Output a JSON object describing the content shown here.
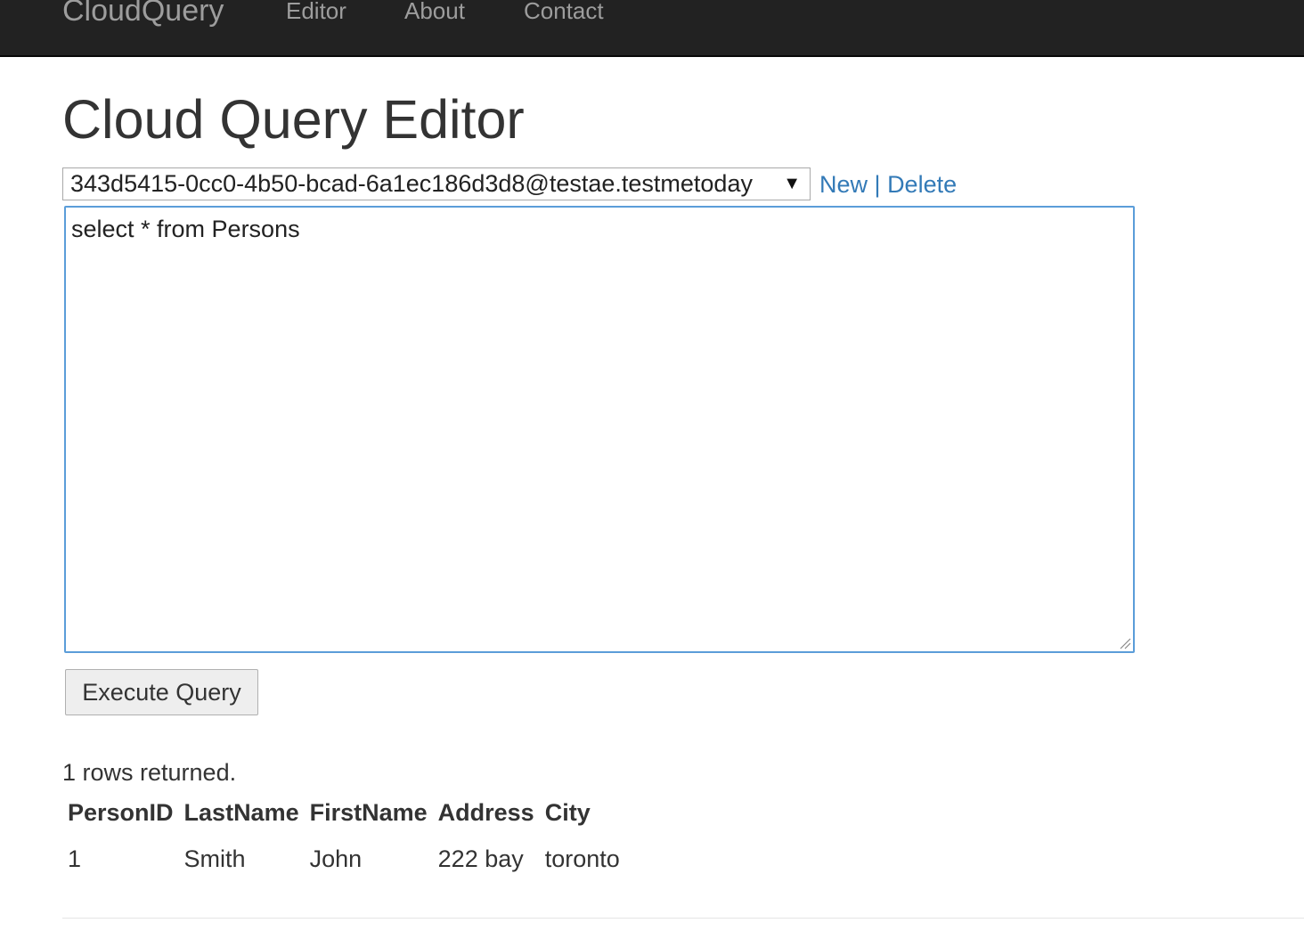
{
  "navbar": {
    "brand": "CloudQuery",
    "links": [
      {
        "label": "Editor"
      },
      {
        "label": "About"
      },
      {
        "label": "Contact"
      }
    ],
    "background": "#222222"
  },
  "page": {
    "title": "Cloud Query Editor"
  },
  "database_select": {
    "selected": "343d5415-0cc0-4b50-bcad-6a1ec186d3d8@testae.testmetoday",
    "arrow": "▼"
  },
  "actions": {
    "new_label": "New",
    "separator": "|",
    "delete_label": "Delete",
    "link_color": "#337ab7"
  },
  "query": {
    "text": "select * from Persons",
    "border_color": "#5b9dd9"
  },
  "execute_button": {
    "label": "Execute Query"
  },
  "results": {
    "status": "1 rows returned.",
    "columns": [
      "PersonID",
      "LastName",
      "FirstName",
      "Address",
      "City"
    ],
    "rows": [
      [
        "1",
        "Smith",
        "John",
        "222 bay",
        "toronto"
      ]
    ]
  }
}
